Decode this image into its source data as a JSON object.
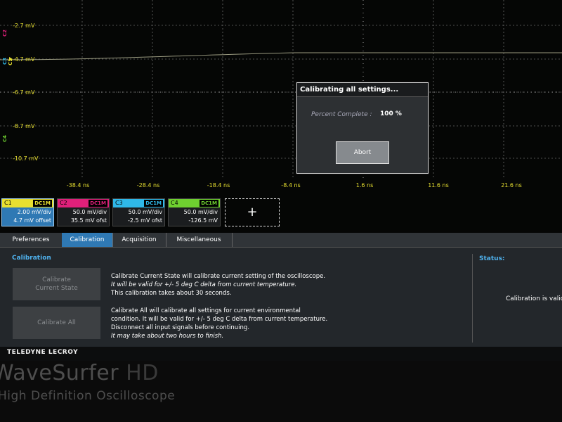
{
  "waveform": {
    "y_labels": [
      "-2.7 mV",
      "-4.7 mV",
      "-6.7 mV",
      "-8.7 mV",
      "-10.7 mV"
    ],
    "x_labels": [
      "-38.4 ns",
      "-28.4 ns",
      "-18.4 ns",
      "-8.4 ns",
      "1.6 ns",
      "11.6 ns",
      "21.6 ns"
    ],
    "channel_markers": [
      {
        "label": "C2",
        "color": "#e0207a"
      },
      {
        "label": "C3",
        "color": "#2fb8e8"
      },
      {
        "label": "C1",
        "color": "#e8e030"
      },
      {
        "label": "C4",
        "color": "#6fd030"
      }
    ]
  },
  "dialog": {
    "title": "Calibrating all settings...",
    "percent_label": "Percent Complete :",
    "percent_value": "100 %",
    "percent_complete": 100,
    "abort_label": "Abort"
  },
  "channels": [
    {
      "name": "C1",
      "coupling": "DC1M",
      "line1": "2.00 mV/div",
      "line2": "4.7 mV offset",
      "color": "#e8e030",
      "selected": true
    },
    {
      "name": "C2",
      "coupling": "DC1M",
      "line1": "50.0 mV/div",
      "line2": "35.5 mV ofst",
      "color": "#e0207a",
      "selected": false
    },
    {
      "name": "C3",
      "coupling": "DC1M",
      "line1": "50.0 mV/div",
      "line2": "-2.5 mV ofst",
      "color": "#2fb8e8",
      "selected": false
    },
    {
      "name": "C4",
      "coupling": "DC1M",
      "line1": "50.0 mV/div",
      "line2": "-126.5 mV",
      "color": "#6fd030",
      "selected": false
    }
  ],
  "add_channel_label": "+",
  "tabs": [
    "Preferences",
    "Calibration",
    "Acquisition",
    "Miscellaneous"
  ],
  "active_tab": "Calibration",
  "calibration": {
    "heading": "Calibration",
    "btn_current": [
      "Calibrate",
      "Current State"
    ],
    "btn_all": "Calibrate All",
    "desc_current": [
      "Calibrate Current State will calibrate current setting of the oscilloscope.",
      "It will be valid for +/- 5 deg C delta from current temperature.",
      "This calibration takes about 30 seconds."
    ],
    "desc_all": [
      "Calibrate All will calibrate all settings for current environmental",
      "condition. It will be valid for +/- 5 deg C delta from current temperature.",
      "Disconnect all input signals before continuing.",
      "It may take about two hours to finish."
    ]
  },
  "status": {
    "heading": "Status:",
    "value": "Calibration is valid"
  },
  "brand": "TELEDYNE LECROY",
  "bezel": {
    "model_a": "WaveSurfer",
    "model_b": " HD",
    "subtitle": "High Definition Oscilloscope"
  },
  "colors": {
    "accent": "#2f79b4",
    "heading_blue": "#4fb2ee",
    "axis_label": "#e8e030"
  }
}
